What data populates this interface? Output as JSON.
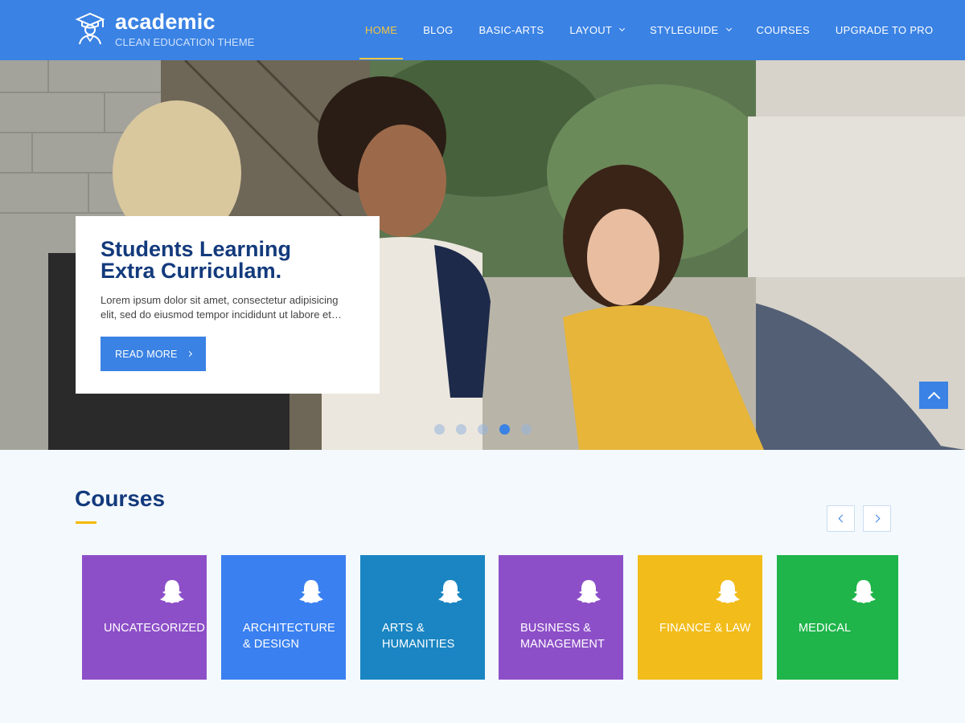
{
  "brand": {
    "name": "academic",
    "tagline": "CLEAN EDUCATION THEME"
  },
  "nav": {
    "items": [
      {
        "label": "HOME",
        "active": true
      },
      {
        "label": "BLOG"
      },
      {
        "label": "BASIC-ARTS"
      },
      {
        "label": "LAYOUT",
        "dropdown": true
      },
      {
        "label": "STYLEGUIDE",
        "dropdown": true
      },
      {
        "label": "COURSES"
      },
      {
        "label": "UPGRADE TO PRO"
      }
    ]
  },
  "hero": {
    "title_line1": "Students Learning",
    "title_line2": "Extra Curriculam.",
    "text": "Lorem ipsum dolor sit amet, consectetur adipisicing elit, sed do eiusmod tempor incididunt ut labore et…",
    "button_label": "READ MORE",
    "slides_total": 5,
    "active_slide": 4
  },
  "courses": {
    "title": "Courses",
    "items": [
      {
        "label": "UNCATEGORIZED",
        "color": "#8d4fc8"
      },
      {
        "label": "ARCHITECTURE & DESIGN",
        "color": "#3a80f0"
      },
      {
        "label": "ARTS & HUMANITIES",
        "color": "#1a85c2"
      },
      {
        "label": "BUSINESS & MANAGEMENT",
        "color": "#8d4fc8"
      },
      {
        "label": "FINANCE & LAW",
        "color": "#f2bc1a"
      },
      {
        "label": "MEDICAL",
        "color": "#1fb54a"
      }
    ],
    "icon": "ghost-icon"
  },
  "colors": {
    "header": "#3a82e4",
    "accent": "#f5c542",
    "heading": "#133a7c"
  }
}
